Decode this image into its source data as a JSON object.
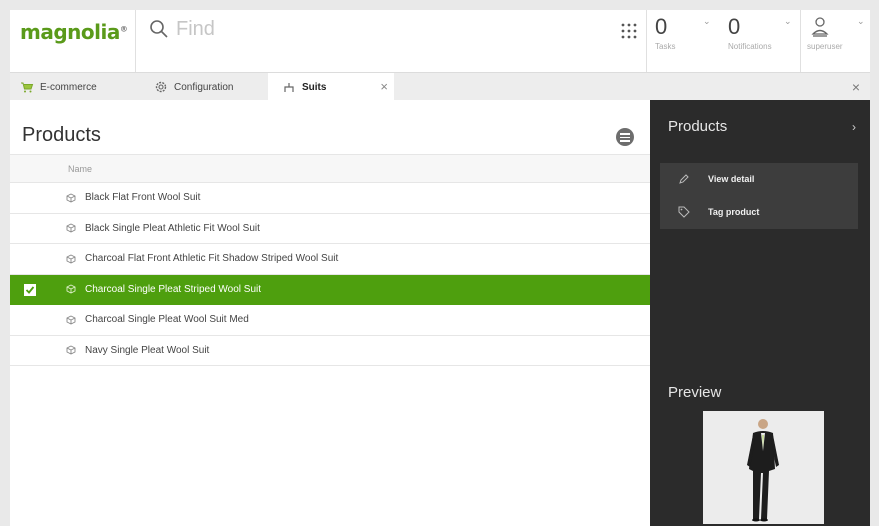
{
  "app": {
    "logo": "magnolia",
    "logo_mark": "®"
  },
  "search": {
    "placeholder": "Find"
  },
  "header": {
    "tasks": {
      "count": "0",
      "label": "Tasks"
    },
    "notifications": {
      "count": "0",
      "label": "Notifications"
    },
    "user": {
      "label": "superuser"
    }
  },
  "tabs": [
    {
      "label": "E-commerce",
      "icon": "cart-icon"
    },
    {
      "label": "Configuration",
      "icon": "gear-icon"
    },
    {
      "label": "Suits",
      "icon": "hierarchy-icon",
      "close": "×"
    }
  ],
  "tabbar_close": "×",
  "main": {
    "title": "Products",
    "table": {
      "column_header": "Name",
      "rows": [
        {
          "name": "Black Flat Front Wool Suit",
          "selected": false
        },
        {
          "name": "Black Single Pleat Athletic Fit Wool Suit",
          "selected": false
        },
        {
          "name": "Charcoal Flat Front Athletic Fit Shadow Striped Wool Suit",
          "selected": false
        },
        {
          "name": "Charcoal Single Pleat Striped Wool Suit",
          "selected": true
        },
        {
          "name": "Charcoal Single Pleat Wool Suit Med",
          "selected": false
        },
        {
          "name": "Navy Single Pleat Wool Suit",
          "selected": false
        }
      ]
    }
  },
  "actionbar": {
    "title": "Products",
    "chevron": "›",
    "actions": [
      {
        "label": "View detail",
        "icon": "pencil-icon"
      },
      {
        "label": "Tag product",
        "icon": "tag-icon"
      }
    ],
    "preview_title": "Preview"
  },
  "colors": {
    "brand_green": "#5a9a1a",
    "selection_green": "#4e9f0e",
    "panel_dark": "#2b2b2b"
  }
}
